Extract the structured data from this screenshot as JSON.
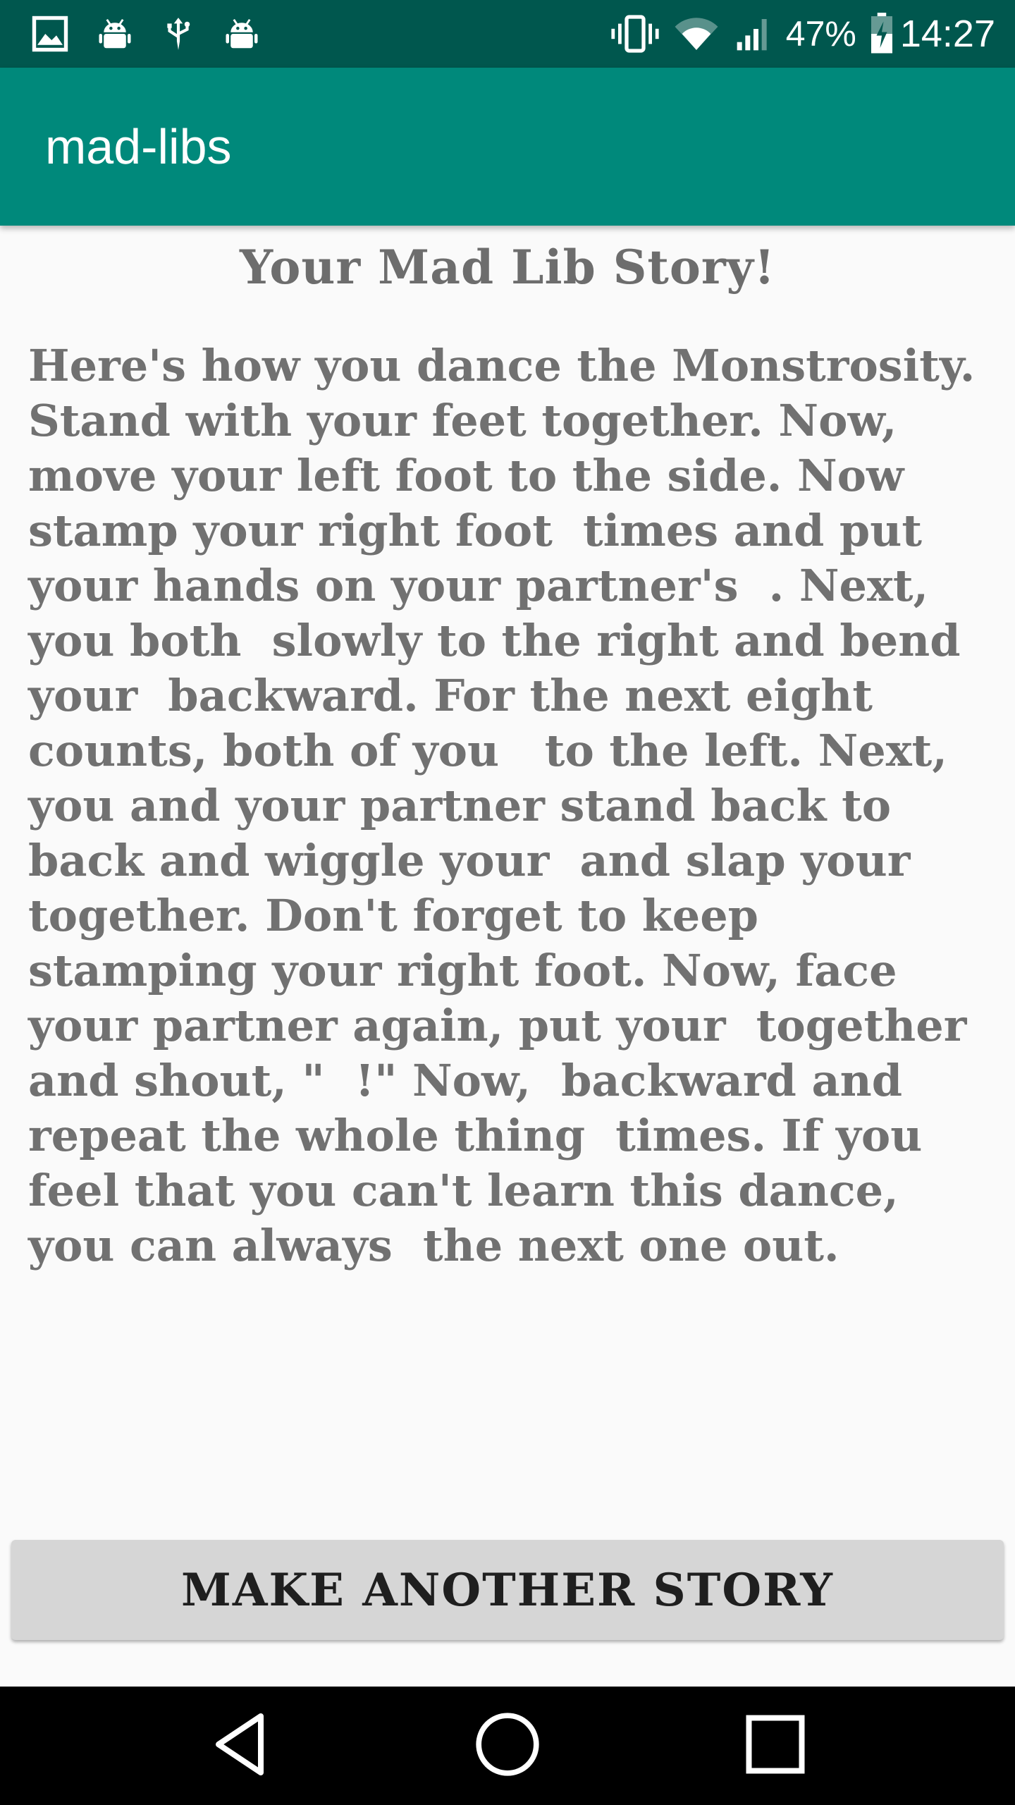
{
  "status_bar": {
    "battery_percent": "47%",
    "time": "14:27",
    "icons_left": [
      "image-icon",
      "android-icon",
      "usb-icon",
      "android-icon"
    ],
    "icons_right": [
      "vibrate-icon",
      "wifi-icon",
      "signal-icon",
      "battery-charging-icon"
    ]
  },
  "app_bar": {
    "title": "mad-libs",
    "color": "#00897b"
  },
  "story": {
    "heading": "Your Mad Lib Story!",
    "text": "Here's how you dance the Monstrosity. Stand with your feet together. Now, move your left foot to the side. Now stamp your right foot  times and put your hands on your partner's  . Next, you both  slowly to the right and bend your  backward. For the next eight counts, both of you   to the left. Next, you and your partner stand back to back and wiggle your  and slap your  together. Don't forget to keep stamping your right foot. Now, face your partner again, put your  together and shout, \"  !\" Now,  backward and repeat the whole thing  times. If you feel that you can't learn this dance, you can always  the next one out."
  },
  "button": {
    "label": "MAKE ANOTHER STORY"
  },
  "nav_bar": {
    "icons": [
      "back-icon",
      "home-icon",
      "recents-icon"
    ]
  }
}
